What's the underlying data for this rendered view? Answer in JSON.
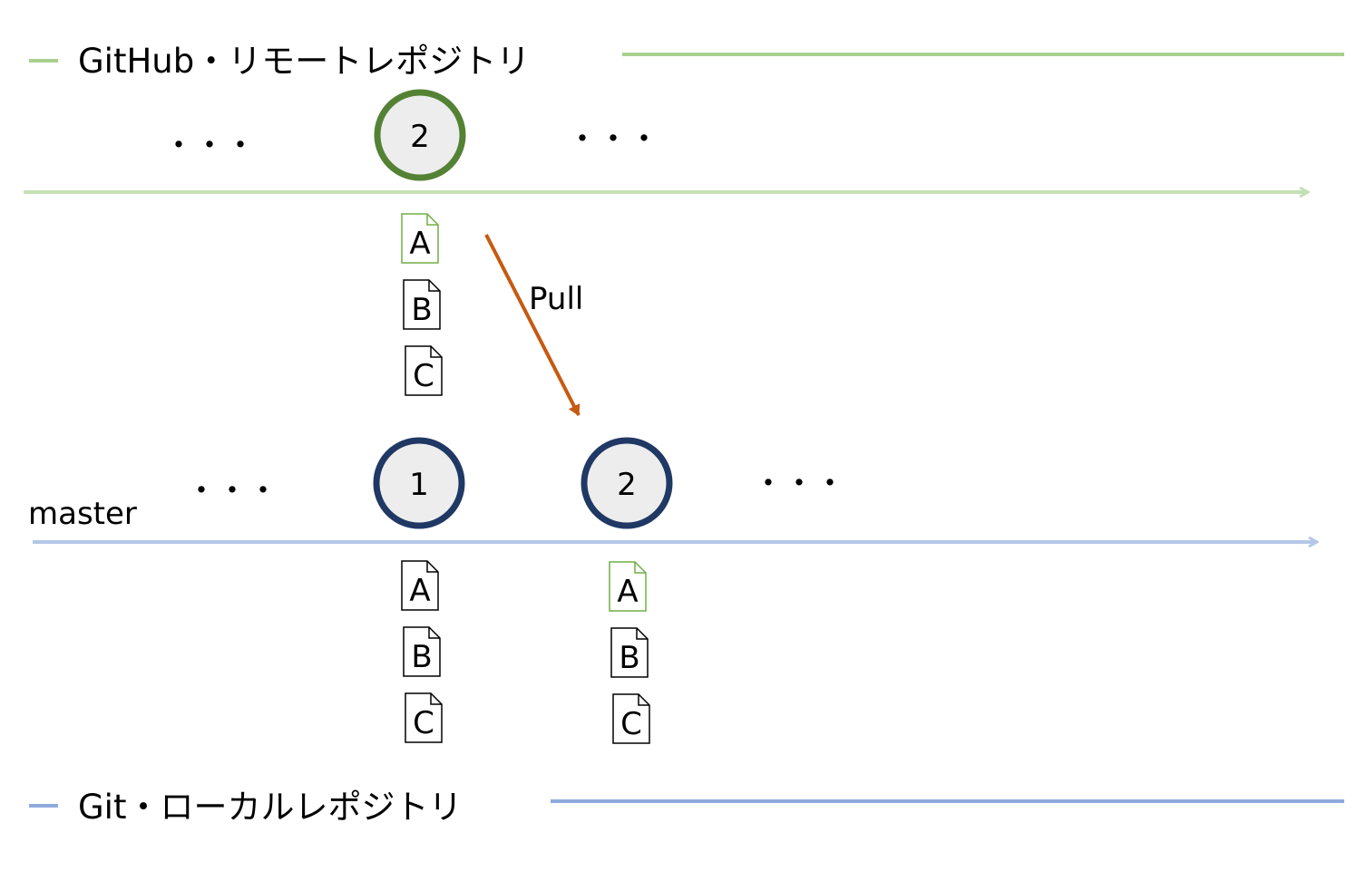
{
  "colors": {
    "remote_line": "#a9d18e",
    "remote_axis": "#c5e0b4",
    "remote_node_stroke": "#548235",
    "local_line": "#8faadc",
    "local_axis": "#b4c7e7",
    "local_node_stroke": "#203864",
    "node_fill": "#ededed",
    "pull_arrow": "#c55a11",
    "file_changed": "#70ad47",
    "file_normal": "#000000",
    "text": "#000000"
  },
  "remote": {
    "title": "GitHub・リモートレポジトリ",
    "ellipsis_left": "・・・",
    "ellipsis_right": "・・・",
    "commit": {
      "label": "2",
      "files": [
        {
          "label": "A",
          "changed": true
        },
        {
          "label": "B",
          "changed": false
        },
        {
          "label": "C",
          "changed": false
        }
      ]
    }
  },
  "pull": {
    "label": "Pull"
  },
  "local": {
    "title": "Git・ローカルレポジトリ",
    "branch": "master",
    "ellipsis_left": "・・・",
    "ellipsis_right": "・・・",
    "commits": [
      {
        "label": "1",
        "files": [
          {
            "label": "A",
            "changed": false
          },
          {
            "label": "B",
            "changed": false
          },
          {
            "label": "C",
            "changed": false
          }
        ]
      },
      {
        "label": "2",
        "files": [
          {
            "label": "A",
            "changed": true
          },
          {
            "label": "B",
            "changed": false
          },
          {
            "label": "C",
            "changed": false
          }
        ]
      }
    ]
  }
}
